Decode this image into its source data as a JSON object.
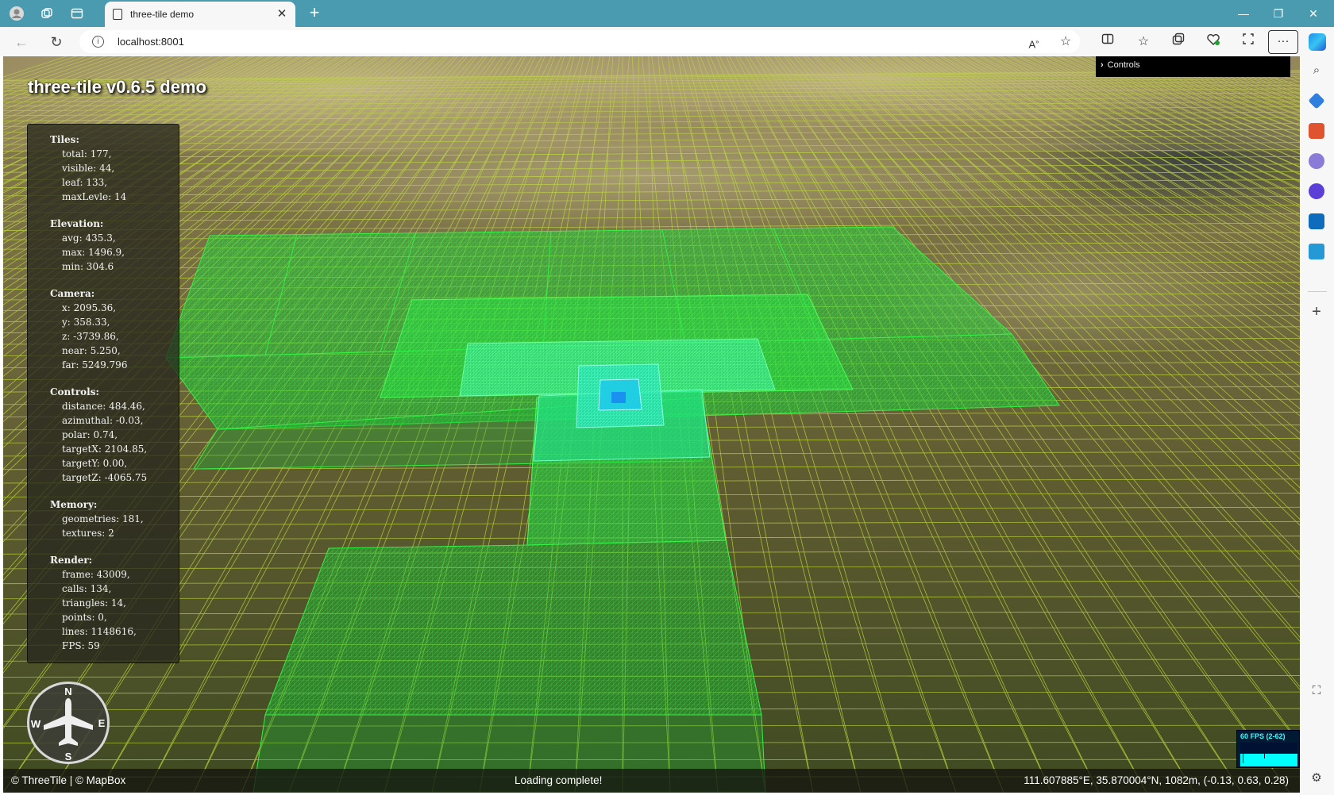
{
  "browser": {
    "tab_title": "three-tile demo",
    "tab_close": "✕",
    "new_tab": "+",
    "address": "localhost:8001",
    "window_controls": {
      "minimize": "—",
      "restore": "❐",
      "close": "✕"
    },
    "more_label": "···"
  },
  "app": {
    "title": "three-tile v0.6.5 demo",
    "controls_label": "Controls",
    "controls_chevron": "›"
  },
  "stats": {
    "tiles": {
      "heading": "Tiles:",
      "rows": [
        "total: 177,",
        "visible: 44,",
        "leaf: 133,",
        "maxLevle: 14"
      ]
    },
    "elevation": {
      "heading": "Elevation:",
      "rows": [
        "avg: 435.3,",
        "max: 1496.9,",
        "min: 304.6"
      ]
    },
    "camera": {
      "heading": "Camera:",
      "rows": [
        "x: 2095.36,",
        "y: 358.33,",
        "z: -3739.86,",
        "near: 5.250,",
        "far: 5249.796"
      ]
    },
    "controls": {
      "heading": "Controls:",
      "rows": [
        "distance: 484.46,",
        "azimuthal: -0.03,",
        "polar: 0.74,",
        "targetX: 2104.85,",
        "targetY: 0.00,",
        "targetZ: -4065.75"
      ]
    },
    "memory": {
      "heading": "Memory:",
      "rows": [
        "geometries: 181,",
        "textures: 2"
      ]
    },
    "render": {
      "heading": "Render:",
      "rows": [
        "frame: 43009,",
        "calls: 134,",
        "triangles: 14,",
        "points: 0,",
        "lines: 1148616,",
        "FPS: 59"
      ]
    }
  },
  "compass": {
    "n": "N",
    "s": "S",
    "e": "E",
    "w": "W"
  },
  "fps_meter": {
    "label": "60 FPS (2-62)"
  },
  "status": {
    "attribution": "© ThreeTile | © MapBox",
    "message": "Loading complete!",
    "coords": "111.607885°E, 35.870004°N, 1082m, (-0.13, 0.63, 0.28)"
  },
  "colors": {
    "tab_strip": "#4a9bb0",
    "wire_yellow": "#c8e03a",
    "tile_green": "#22d13d",
    "tile_cyan": "#19e6b8",
    "fps_cyan": "#00ffff"
  }
}
